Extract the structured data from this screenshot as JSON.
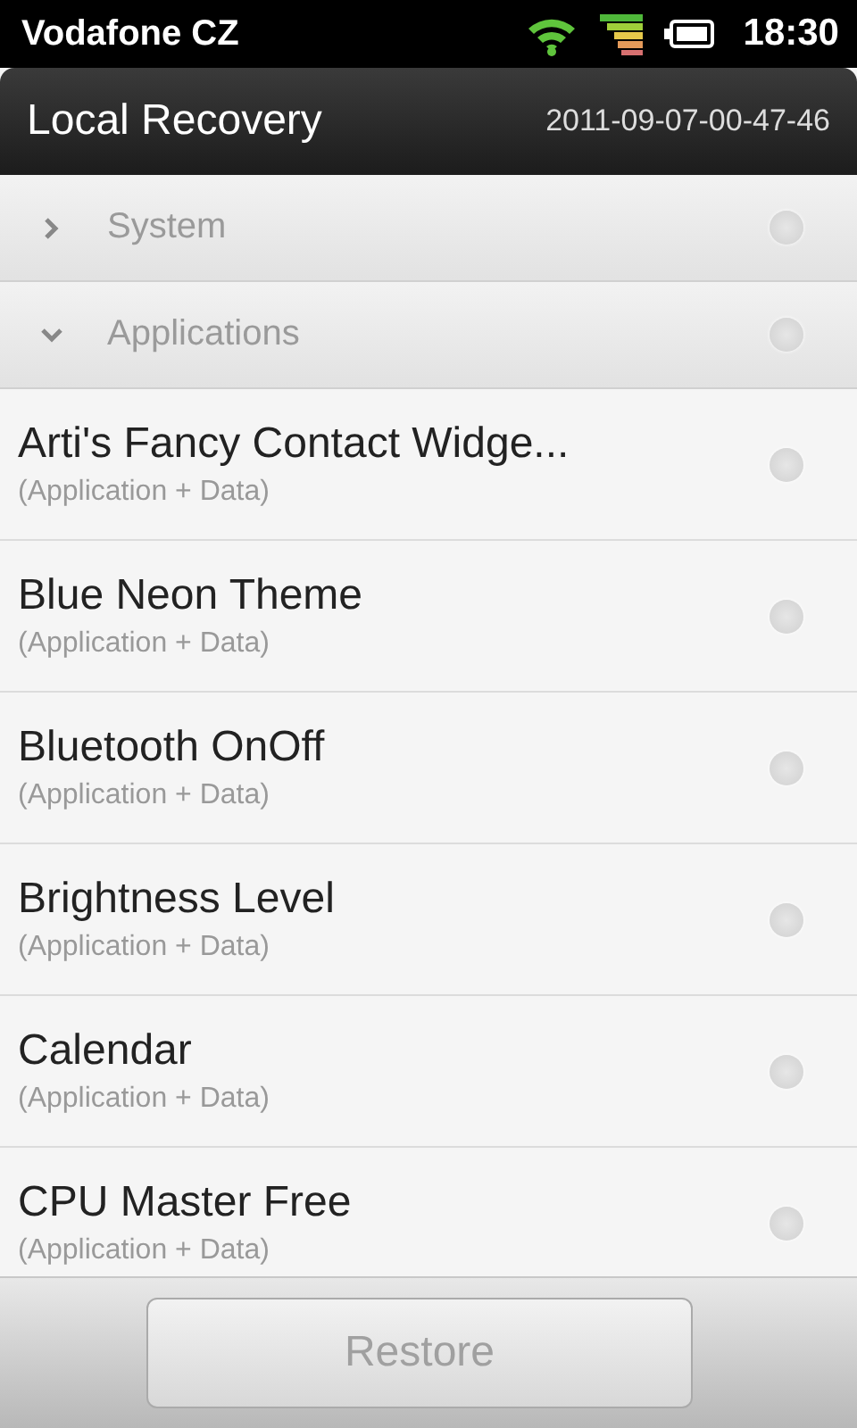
{
  "status_bar": {
    "carrier": "Vodafone CZ",
    "time": "18:30"
  },
  "header": {
    "title": "Local Recovery",
    "subtitle": "2011-09-07-00-47-46"
  },
  "groups": [
    {
      "label": "System",
      "expanded": false,
      "selected": false
    },
    {
      "label": "Applications",
      "expanded": true,
      "selected": false,
      "items": [
        {
          "name": "Arti's Fancy Contact Widge...",
          "detail": "(Application + Data)",
          "selected": false
        },
        {
          "name": "Blue Neon Theme",
          "detail": "(Application + Data)",
          "selected": false
        },
        {
          "name": "Bluetooth OnOff",
          "detail": "(Application + Data)",
          "selected": false
        },
        {
          "name": "Brightness Level",
          "detail": "(Application + Data)",
          "selected": false
        },
        {
          "name": "Calendar",
          "detail": "(Application + Data)",
          "selected": false
        },
        {
          "name": "CPU Master Free",
          "detail": "(Application + Data)",
          "selected": false
        }
      ]
    }
  ],
  "restore_button": {
    "label": "Restore",
    "disabled": true
  }
}
